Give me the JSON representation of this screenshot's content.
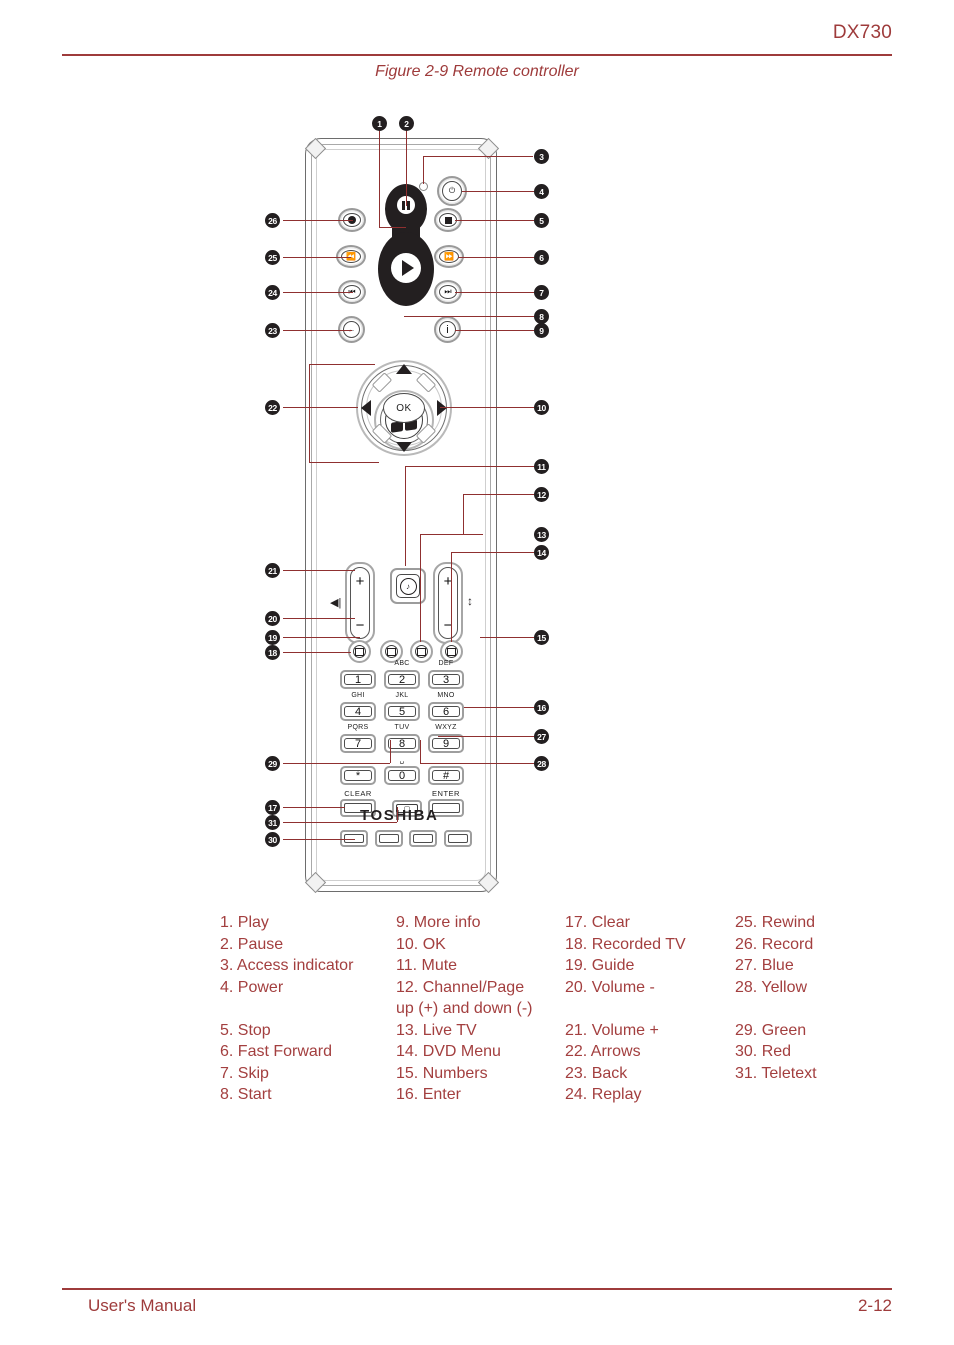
{
  "header": {
    "model": "DX730"
  },
  "figure": {
    "caption": "Figure 2-9 Remote controller"
  },
  "footer": {
    "left": "User's Manual",
    "right": "2-12"
  },
  "colors": {
    "accent": "#a33f3f",
    "rule": "#9e3b3b",
    "bullet": "#231f20",
    "leader": "#8f3030"
  },
  "remote": {
    "brand": "TOSHIBA",
    "ok_label": "OK",
    "keypad": {
      "keys": [
        "1",
        "2",
        "3",
        "4",
        "5",
        "6",
        "7",
        "8",
        "9",
        "*",
        "0",
        "#"
      ],
      "letter_labels": [
        "",
        "ABC",
        "DEF",
        "GHI",
        "JKL",
        "MNO",
        "PQRS",
        "TUV",
        "WXYZ",
        "",
        "␣",
        ""
      ]
    },
    "bottom_labels": {
      "clear": "CLEAR",
      "enter": "ENTER"
    },
    "icons": {
      "play": "play-icon",
      "pause": "pause-icon",
      "power": "power-icon",
      "record": "record-icon",
      "stop": "stop-icon",
      "rewind": "rewind-icon",
      "fast_forward": "fast-forward-icon",
      "skip": "skip-icon",
      "replay": "replay-icon",
      "back": "back-arrow-icon",
      "start": "windows-start-icon",
      "more_info": "info-icon",
      "mute": "mute-speaker-icon",
      "volume": "speaker-icon",
      "channel": "up-down-arrow-icon",
      "teletext": "teletext-icon"
    }
  },
  "callouts": [
    {
      "n": "1"
    },
    {
      "n": "2"
    },
    {
      "n": "3"
    },
    {
      "n": "4"
    },
    {
      "n": "5"
    },
    {
      "n": "6"
    },
    {
      "n": "7"
    },
    {
      "n": "8"
    },
    {
      "n": "9"
    },
    {
      "n": "10"
    },
    {
      "n": "11"
    },
    {
      "n": "12"
    },
    {
      "n": "13"
    },
    {
      "n": "14"
    },
    {
      "n": "15"
    },
    {
      "n": "16"
    },
    {
      "n": "17"
    },
    {
      "n": "18"
    },
    {
      "n": "19"
    },
    {
      "n": "20"
    },
    {
      "n": "21"
    },
    {
      "n": "22"
    },
    {
      "n": "23"
    },
    {
      "n": "24"
    },
    {
      "n": "25"
    },
    {
      "n": "26"
    },
    {
      "n": "27"
    },
    {
      "n": "28"
    },
    {
      "n": "29"
    },
    {
      "n": "30"
    },
    {
      "n": "31"
    }
  ],
  "legend": {
    "col1": [
      "1. Play",
      "2. Pause",
      "3. Access indicator",
      "4. Power",
      "",
      "5. Stop",
      "6. Fast Forward",
      "7. Skip",
      "8. Start"
    ],
    "col2": [
      "9. More info",
      "10. OK",
      "11. Mute",
      "12. Channel/Page",
      "up (+) and down (-)",
      "13. Live TV",
      "14. DVD Menu",
      "15. Numbers",
      "16. Enter"
    ],
    "col3": [
      "17. Clear",
      "18. Recorded TV",
      "19. Guide",
      "20. Volume -",
      "",
      "21. Volume +",
      "22. Arrows",
      "23. Back",
      "24. Replay"
    ],
    "col4": [
      "25. Rewind",
      "26. Record",
      "27. Blue",
      "28. Yellow",
      "",
      "29. Green",
      "30. Red",
      "31. Teletext",
      ""
    ]
  }
}
